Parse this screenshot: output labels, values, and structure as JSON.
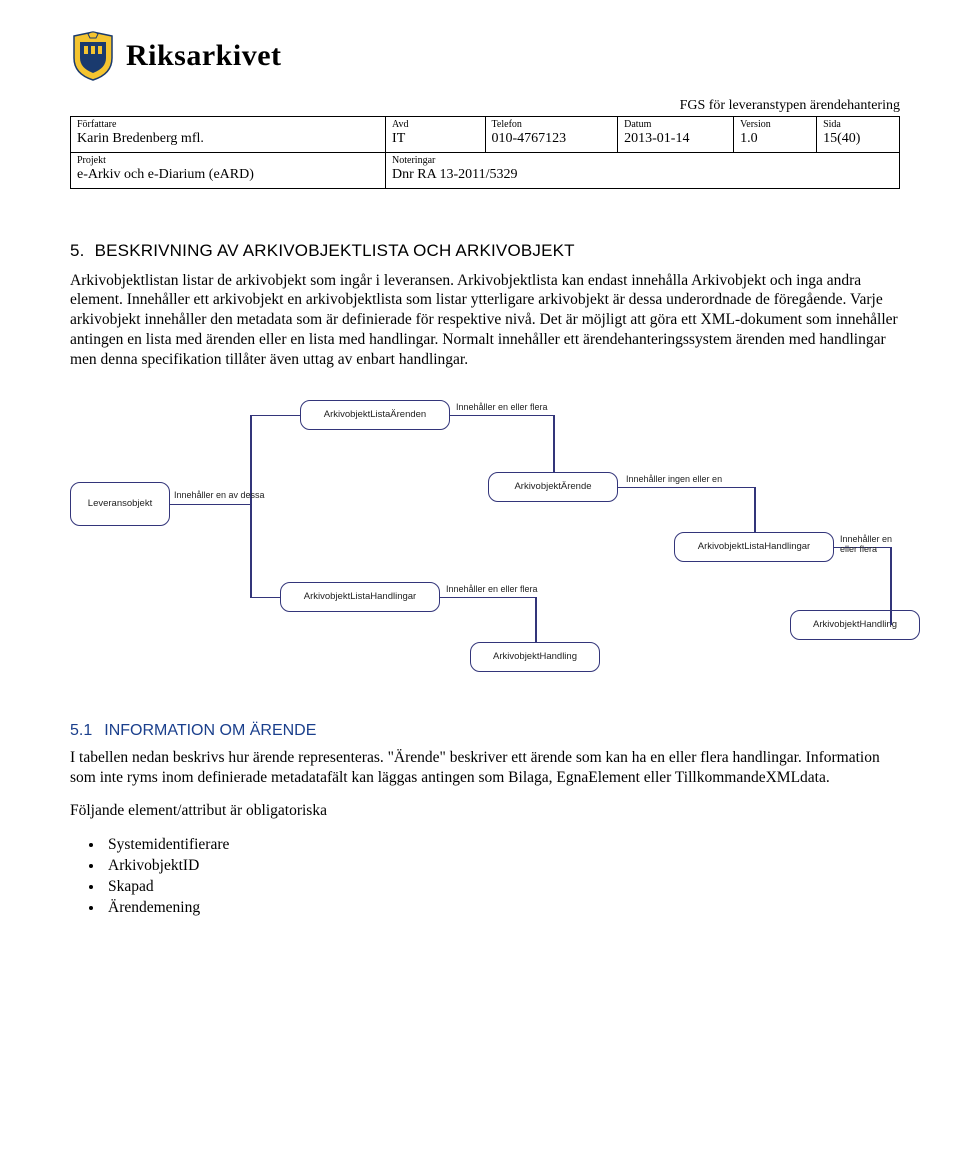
{
  "header": {
    "org_name": "Riksarkivet",
    "supertitle": "FGS för leveranstypen ärendehantering",
    "meta": {
      "forfattare_label": "Författare",
      "forfattare": "Karin Bredenberg mfl.",
      "avd_label": "Avd",
      "avd": "IT",
      "telefon_label": "Telefon",
      "telefon": "010-4767123",
      "datum_label": "Datum",
      "datum": "2013-01-14",
      "version_label": "Version",
      "version": "1.0",
      "sida_label": "Sida",
      "sida": "15(40)",
      "projekt_label": "Projekt",
      "projekt": "e-Arkiv och e-Diarium (eARD)",
      "noteringar_label": "Noteringar",
      "noteringar": "Dnr RA 13-2011/5329"
    }
  },
  "section5": {
    "num": "5.",
    "title": "BESKRIVNING AV ARKIVOBJEKTLISTA OCH ARKIVOBJEKT",
    "body": "Arkivobjektlistan listar de arkivobjekt som ingår i leveransen. Arkivobjektlista kan endast innehålla Arkivobjekt och inga andra element. Innehåller ett arkivobjekt en arkivobjektlista som listar ytterligare arkivobjekt är dessa underordnade de föregående. Varje arkivobjekt innehåller den metadata som är definierade för respektive nivå. Det är möjligt att göra ett XML-dokument som innehåller antingen en lista med ärenden eller en lista med handlingar. Normalt innehåller ett ärendehanteringssystem ärenden med handlingar men denna specifikation tillåter även uttag av enbart handlingar."
  },
  "diagram": {
    "b1": "Leveransobjekt",
    "b2": "ArkivobjektListaÄrenden",
    "b3": "ArkivobjektÄrende",
    "b4": "ArkivobjektListaHandlingar",
    "b5": "ArkivobjektHandling",
    "b6": "ArkivobjektListaHandlingar",
    "b7": "ArkivobjektHandling",
    "l1": "Innehåller en av dessa",
    "l2": "Innehåller en eller flera",
    "l3": "Innehåller ingen eller en",
    "l4": "Innehåller en eller flera",
    "l5": "Innehåller en eller flera"
  },
  "section51": {
    "num": "5.1",
    "title": "INFORMATION OM ÄRENDE",
    "p1": "I tabellen nedan beskrivs hur ärende representeras. \"Ärende\" beskriver ett ärende som kan ha en eller flera handlingar. Information som inte ryms inom definierade metadatafält kan läggas antingen som Bilaga, EgnaElement eller TillkommandeXMLdata.",
    "p2": "Följande element/attribut är obligatoriska",
    "bullets": [
      "Systemidentifierare",
      "ArkivobjektID",
      "Skapad",
      "Ärendemening"
    ]
  }
}
